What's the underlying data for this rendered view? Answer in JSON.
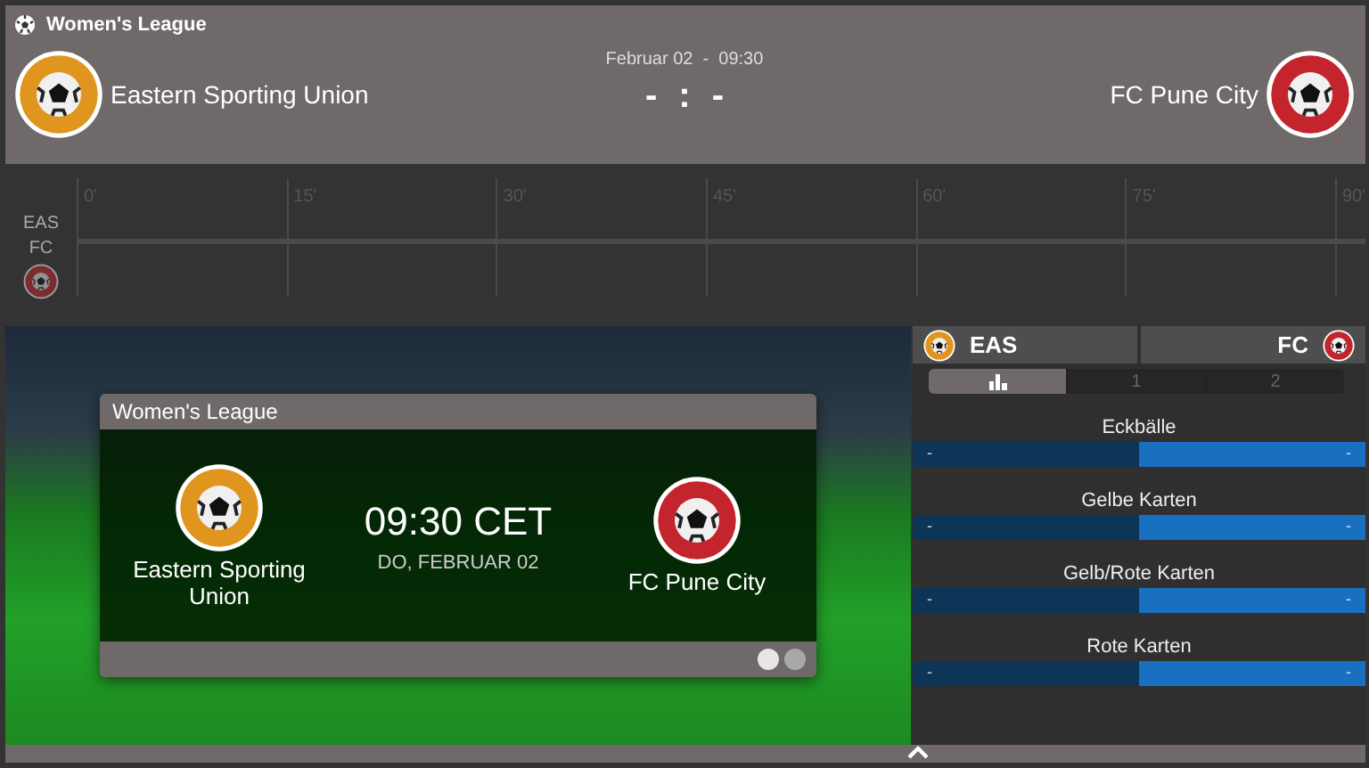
{
  "header": {
    "league": "Women's League",
    "datetime": "Februar 02  -  09:30",
    "score_home": "-",
    "score_separator": ":",
    "score_away": "-",
    "home": "Eastern Sporting Union",
    "away": "FC Pune City"
  },
  "timeline": {
    "ticks": [
      "0'",
      "15'",
      "30'",
      "45'",
      "60'",
      "75'",
      "90'"
    ],
    "home_label": "EAS",
    "away_label": "FC"
  },
  "card": {
    "title": "Women's League",
    "home": "Eastern Sporting Union",
    "away": "FC Pune City",
    "time": "09:30 CET",
    "date": "DO, FEBRUAR 02",
    "dots": [
      {
        "selected": true
      },
      {
        "selected": false
      }
    ]
  },
  "stats": {
    "home": "EAS",
    "away": "FC",
    "tabs": [
      {
        "kind": "icon",
        "selected": true
      },
      {
        "kind": "text",
        "label": "1",
        "selected": false
      },
      {
        "kind": "text",
        "label": "2",
        "selected": false
      }
    ],
    "rows": [
      {
        "label": "Eckbälle",
        "home": "-",
        "away": "-"
      },
      {
        "label": "Gelbe Karten",
        "home": "-",
        "away": "-"
      },
      {
        "label": "Gelb/Rote Karten",
        "home": "-",
        "away": "-"
      },
      {
        "label": "Rote Karten",
        "home": "-",
        "away": "-"
      }
    ]
  }
}
